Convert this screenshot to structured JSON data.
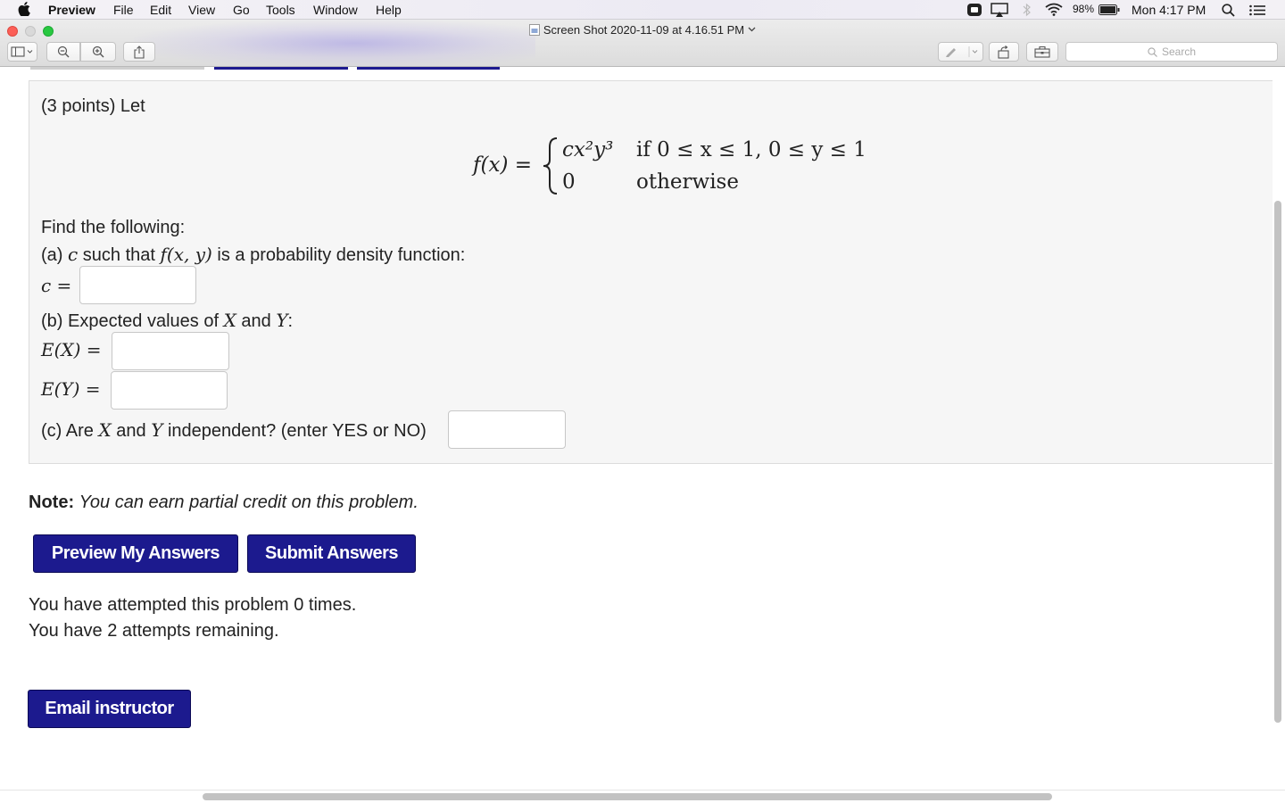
{
  "menubar": {
    "app_name": "Preview",
    "items": [
      "File",
      "Edit",
      "View",
      "Go",
      "Tools",
      "Window",
      "Help"
    ],
    "battery": "98%",
    "clock": "Mon 4:17 PM"
  },
  "window": {
    "title": "Screen Shot 2020-11-09 at 4.16.51 PM",
    "search_placeholder": "Search"
  },
  "problem": {
    "intro": "(3 points) Let",
    "formula": {
      "lhs": "f(x) =",
      "case1_expr": "cx²y³",
      "case1_cond": "if 0 ≤ x ≤ 1, 0 ≤ y ≤ 1",
      "case2_expr": "0",
      "case2_cond": "otherwise"
    },
    "find": "Find the following:",
    "part_a_prefix": "(a)",
    "part_a_var": "c",
    "part_a_mid": "such that",
    "part_a_func": "f(x, y)",
    "part_a_suffix": "is a probability density function:",
    "c_label": "c =",
    "part_b_prefix": "(b) Expected values of",
    "part_b_x": "X",
    "part_b_and": "and",
    "part_b_y": "Y",
    "part_b_colon": ":",
    "ex_label": "E(X) =",
    "ey_label": "E(Y) =",
    "part_c_prefix": "(c) Are",
    "part_c_x": "X",
    "part_c_and": "and",
    "part_c_y": "Y",
    "part_c_suffix": "independent? (enter YES or NO)"
  },
  "note_label": "Note:",
  "note_text": "You can earn partial credit on this problem.",
  "buttons": {
    "preview": "Preview My Answers",
    "submit": "Submit Answers",
    "email": "Email instructor"
  },
  "status": {
    "attempted": "You have attempted this problem 0 times.",
    "remaining": "You have 2 attempts remaining."
  },
  "colors": {
    "button_bg": "#1c1a8e",
    "close": "#fc5f57",
    "minimize": "#fdbc2e",
    "zoom": "#28c840"
  }
}
